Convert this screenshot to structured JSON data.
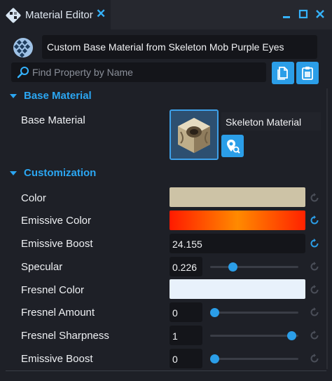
{
  "window": {
    "tab_title": "Material Editor",
    "accent_color": "#2b9ee8",
    "icons": [
      "material-editor-icon",
      "close-icon",
      "minimize-icon",
      "maximize-icon",
      "window-close-icon"
    ]
  },
  "header": {
    "material_name": "Custom Base Material from Skeleton Mob Purple Eyes",
    "icon": "checker-sphere-icon"
  },
  "search": {
    "placeholder": "Find Property by Name",
    "icon": "search-icon"
  },
  "toolbar": {
    "copy_icon": "copy-icon",
    "paste_icon": "clipboard-icon"
  },
  "sections": {
    "base_material": {
      "title": "Base Material",
      "label": "Base Material",
      "value": "Skeleton Material",
      "action_icon": "locate-asset-icon"
    },
    "customization": {
      "title": "Customization",
      "properties": {
        "color": {
          "label": "Color",
          "value_color": "#cdc3a6"
        },
        "emissive_color": {
          "label": "Emissive Color",
          "gradient": [
            "#ff1a00",
            "#ff8a00",
            "#ff2200"
          ]
        },
        "emissive_boost": {
          "label": "Emissive Boost",
          "value": "24.155"
        },
        "specular": {
          "label": "Specular",
          "value": "0.226",
          "fraction": 0.25
        },
        "fresnel_color": {
          "label": "Fresnel Color",
          "value_color": "#e8f1fb"
        },
        "fresnel_amount": {
          "label": "Fresnel Amount",
          "value": "0",
          "fraction": 0.05
        },
        "fresnel_sharpness": {
          "label": "Fresnel Sharpness",
          "value": "1",
          "fraction": 0.92
        },
        "emissive_boost_2": {
          "label": "Emissive Boost",
          "value": "0",
          "fraction": 0.05
        }
      }
    }
  }
}
